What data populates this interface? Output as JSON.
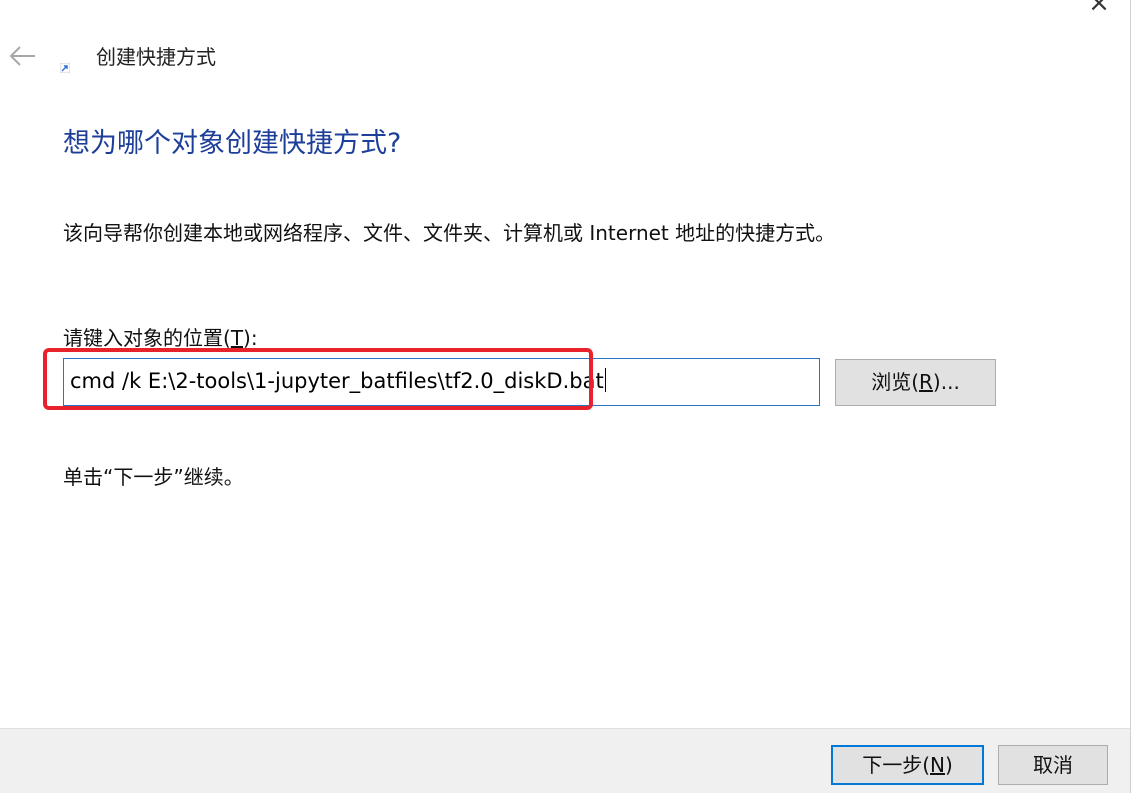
{
  "window": {
    "title": "创建快捷方式",
    "close_glyph": "×"
  },
  "icons": {
    "back": "back-arrow-icon",
    "shortcut": "shortcut-icon",
    "close": "close-icon"
  },
  "colors": {
    "heading": "#1e3f99",
    "input_border": "#2a73c9",
    "highlight": "#e8222a",
    "default_button_border": "#0078d7",
    "footer_background": "#f0f0f0"
  },
  "main": {
    "heading": "想为哪个对象创建快捷方式?",
    "description": "该向导帮你创建本地或网络程序、文件、文件夹、计算机或 Internet 地址的快捷方式。",
    "location_label_prefix": "请键入对象的位置(",
    "location_label_key": "T",
    "location_label_suffix": "):",
    "location_value": "cmd /k E:\\2-tools\\1-jupyter_batfiles\\tf2.0_diskD.bat",
    "browse_prefix": "浏览(",
    "browse_key": "R",
    "browse_suffix": ")...",
    "continue_hint": "单击“下一步”继续。"
  },
  "footer": {
    "next_prefix": "下一步(",
    "next_key": "N",
    "next_suffix": ")",
    "cancel_label": "取消"
  }
}
